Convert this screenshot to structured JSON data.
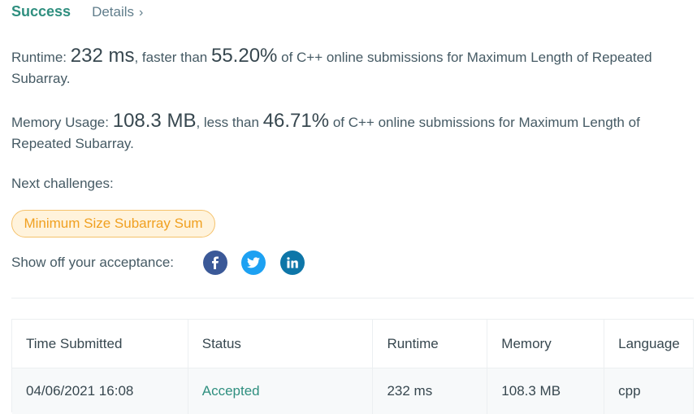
{
  "header": {
    "status": "Success",
    "details_label": "Details",
    "details_chevron": "›"
  },
  "runtime": {
    "label": "Runtime:",
    "value": "232 ms",
    "comparison": ", faster than",
    "percent": "55.20%",
    "suffix": "of C++ online submissions for Maximum Length of Repeated Subarray."
  },
  "memory": {
    "label": "Memory Usage:",
    "value": "108.3 MB",
    "comparison": ", less than",
    "percent": "46.71%",
    "suffix": "of C++ online submissions for Maximum Length of Repeated Subarray."
  },
  "next": {
    "label": "Next challenges:",
    "challenge": "Minimum Size Subarray Sum"
  },
  "share": {
    "label": "Show off your acceptance:",
    "icons": [
      "facebook-icon",
      "twitter-icon",
      "linkedin-icon"
    ],
    "colors": {
      "facebook": "#3b5998",
      "twitter": "#1da1f2",
      "linkedin": "#0e76a8"
    }
  },
  "table": {
    "headers": [
      "Time Submitted",
      "Status",
      "Runtime",
      "Memory",
      "Language"
    ],
    "rows": [
      [
        "04/06/2021 16:08",
        "Accepted",
        "232 ms",
        "108.3 MB",
        "cpp"
      ]
    ]
  },
  "colors": {
    "success": "#2f8f7f",
    "challenge_text": "#f0a020",
    "challenge_bg": "#fff3dc"
  }
}
